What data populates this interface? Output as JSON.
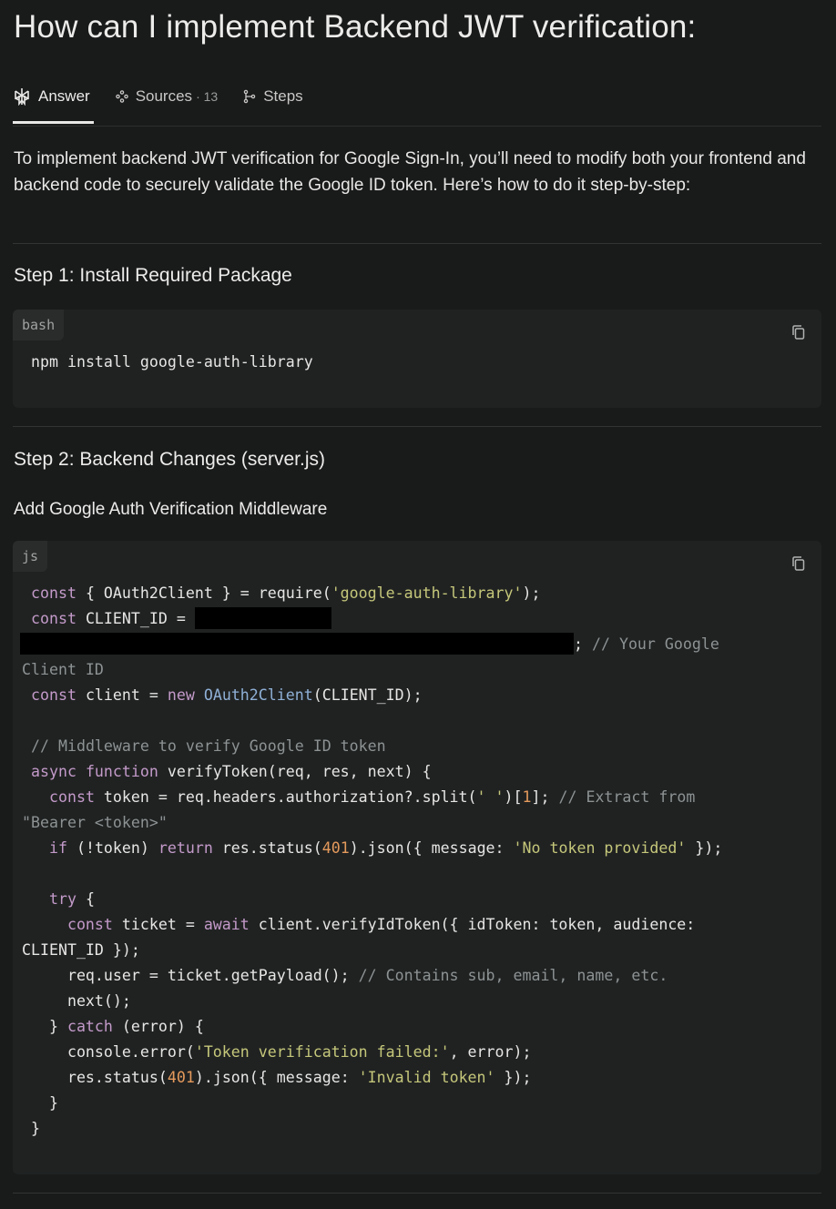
{
  "title": "How can I implement Backend JWT verification:",
  "tabs": [
    {
      "label": "Answer",
      "icon": "perplexity-icon",
      "active": true
    },
    {
      "label": "Sources",
      "count": "· 13",
      "icon": "sources-icon"
    },
    {
      "label": "Steps",
      "icon": "steps-icon"
    }
  ],
  "intro": "To implement backend JWT verification for Google Sign-In, you’ll need to modify both your frontend and backend code to securely validate the Google ID token. Here’s how to do it step-by-step:",
  "step1": {
    "heading": "Step 1: Install Required Package",
    "lang": "bash",
    "code": "npm install google-auth-library"
  },
  "step2": {
    "heading": "Step 2: Backend Changes (server.js)",
    "subheading": "Add Google Auth Verification Middleware",
    "lang": "js",
    "lines": [
      [
        [
          "t",
          " "
        ],
        [
          "k",
          "const"
        ],
        [
          "t",
          " { OAuth2Client } = require("
        ],
        [
          "s",
          "'google-auth-library'"
        ],
        [
          "t",
          ");"
        ]
      ],
      [
        [
          "t",
          " "
        ],
        [
          "k",
          "const"
        ],
        [
          "t",
          " CLIENT_ID = "
        ],
        [
          "ra",
          ""
        ]
      ],
      [
        [
          "rb",
          ""
        ],
        [
          "t",
          "; "
        ],
        [
          "c",
          "// Your Google"
        ]
      ],
      [
        [
          "c",
          "Client ID"
        ]
      ],
      [
        [
          "t",
          " "
        ],
        [
          "k",
          "const"
        ],
        [
          "t",
          " client = "
        ],
        [
          "k",
          "new"
        ],
        [
          "t",
          " "
        ],
        [
          "f",
          "OAuth2Client"
        ],
        [
          "t",
          "(CLIENT_ID);"
        ]
      ],
      [],
      [
        [
          "t",
          " "
        ],
        [
          "c",
          "// Middleware to verify Google ID token"
        ]
      ],
      [
        [
          "t",
          " "
        ],
        [
          "k",
          "async function"
        ],
        [
          "t",
          " verifyToken(req, res, next) {"
        ]
      ],
      [
        [
          "t",
          "   "
        ],
        [
          "k",
          "const"
        ],
        [
          "t",
          " token = req.headers.authorization?.split("
        ],
        [
          "s",
          "' '"
        ],
        [
          "t",
          ")["
        ],
        [
          "n",
          "1"
        ],
        [
          "t",
          "]; "
        ],
        [
          "c",
          "// Extract from"
        ]
      ],
      [
        [
          "c",
          "\"Bearer <token>\""
        ]
      ],
      [
        [
          "t",
          "   "
        ],
        [
          "k",
          "if"
        ],
        [
          "t",
          " (!token) "
        ],
        [
          "k",
          "return"
        ],
        [
          "t",
          " res.status("
        ],
        [
          "n",
          "401"
        ],
        [
          "t",
          ").json({ message: "
        ],
        [
          "s",
          "'No token provided'"
        ],
        [
          "t",
          " });"
        ]
      ],
      [],
      [
        [
          "t",
          "   "
        ],
        [
          "k",
          "try"
        ],
        [
          "t",
          " {"
        ]
      ],
      [
        [
          "t",
          "     "
        ],
        [
          "k",
          "const"
        ],
        [
          "t",
          " ticket = "
        ],
        [
          "k",
          "await"
        ],
        [
          "t",
          " client.verifyIdToken({ idToken: token, audience:"
        ]
      ],
      [
        [
          "t",
          "CLIENT_ID });"
        ]
      ],
      [
        [
          "t",
          "     req.user = ticket.getPayload(); "
        ],
        [
          "c",
          "// Contains sub, email, name, etc."
        ]
      ],
      [
        [
          "t",
          "     next();"
        ]
      ],
      [
        [
          "t",
          "   } "
        ],
        [
          "k",
          "catch"
        ],
        [
          "t",
          " (error) {"
        ]
      ],
      [
        [
          "t",
          "     console.error("
        ],
        [
          "s",
          "'Token verification failed:'"
        ],
        [
          "t",
          ", error);"
        ]
      ],
      [
        [
          "t",
          "     res.status("
        ],
        [
          "n",
          "401"
        ],
        [
          "t",
          ").json({ message: "
        ],
        [
          "s",
          "'Invalid token'"
        ],
        [
          "t",
          " });"
        ]
      ],
      [
        [
          "t",
          "   }"
        ]
      ],
      [
        [
          "t",
          " }"
        ]
      ]
    ]
  }
}
